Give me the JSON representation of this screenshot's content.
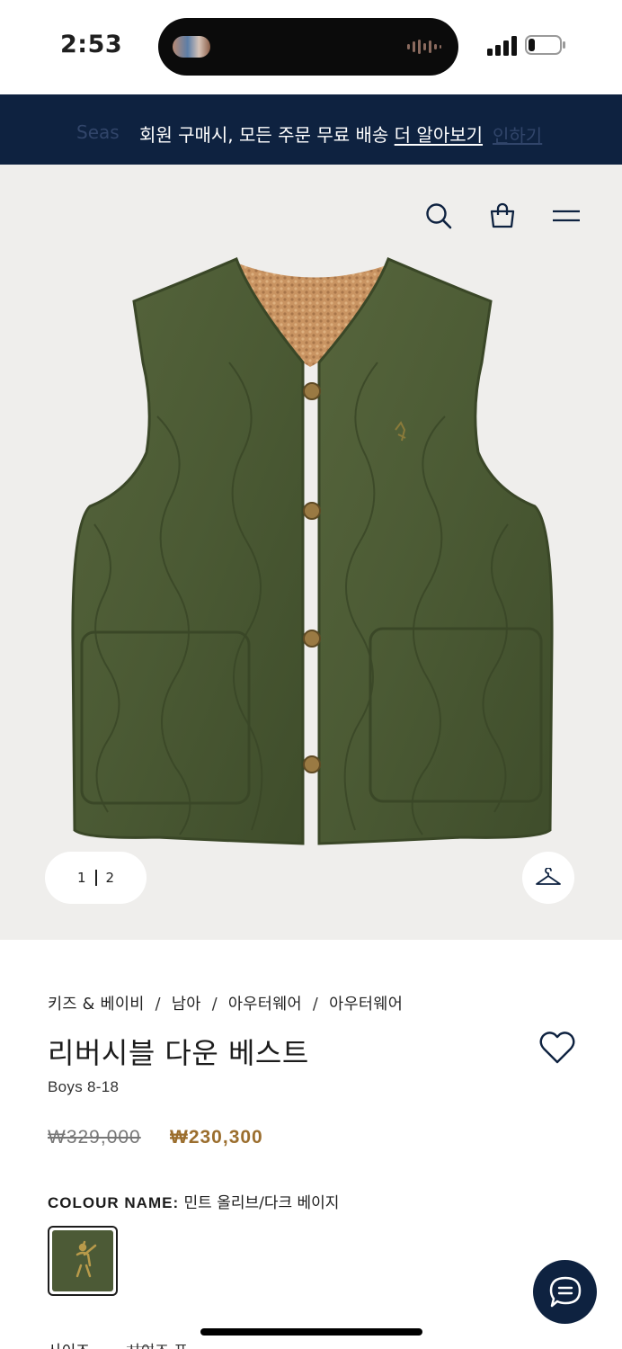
{
  "status_bar": {
    "time": "2:53"
  },
  "promo": {
    "ghost_left": "Seas",
    "ghost_right": "인하기",
    "text": "회원 구매시, 모든 주문 무료 배송",
    "link": "더 알아보기"
  },
  "header_icons": [
    "search-icon",
    "shopping-bag-icon",
    "menu-icon"
  ],
  "gallery": {
    "page_current": "1",
    "page_total": "2"
  },
  "product": {
    "breadcrumb": [
      "키즈 & 베이비",
      "남아",
      "아우터웨어",
      "아우터웨어"
    ],
    "title": "리버시블 다운 베스트",
    "size_range": "Boys 8-18",
    "price_original": "₩329,000",
    "price_sale": "₩230,300",
    "colour_label": "COLOUR NAME:",
    "colour_value": "민트 올리브/다크 베이지",
    "size_label": "사이즈",
    "size_guide": "사이즈 표"
  },
  "colors": {
    "navy": "#0e2240",
    "sale_price": "#9b6e2e",
    "vest_green": "#4c5a36",
    "image_bg": "#efeeec"
  }
}
